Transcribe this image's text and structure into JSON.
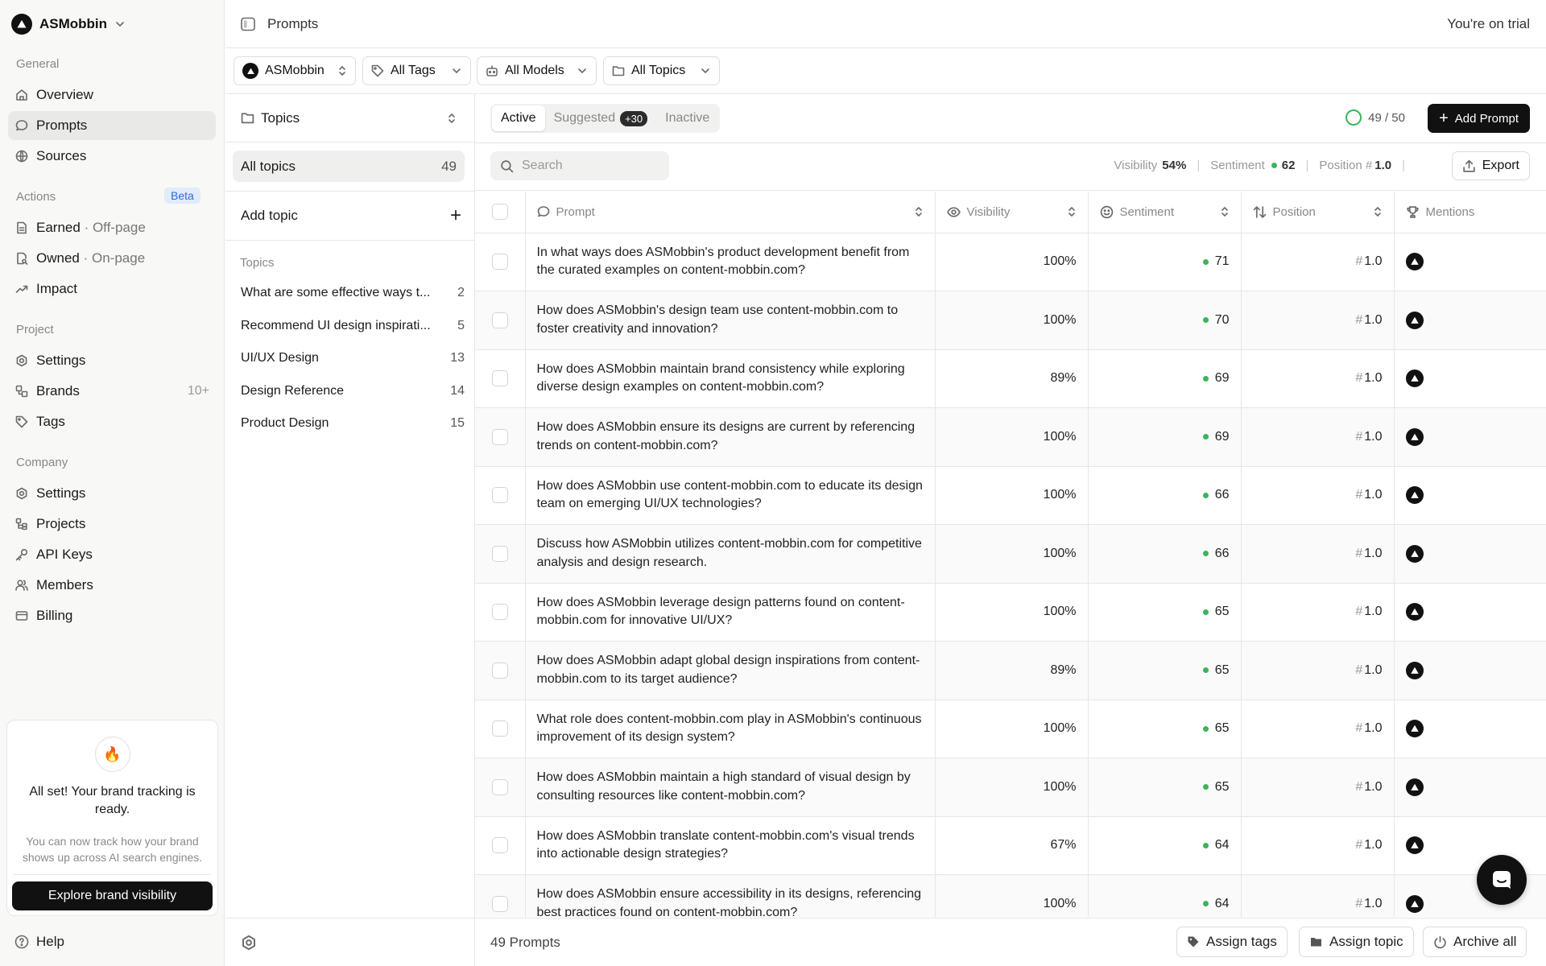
{
  "org": {
    "name": "ASMobbin"
  },
  "sidebar": {
    "sections": {
      "general": "General",
      "actions": "Actions",
      "project": "Project",
      "company": "Company"
    },
    "general": [
      {
        "label": "Overview"
      },
      {
        "label": "Prompts"
      },
      {
        "label": "Sources"
      }
    ],
    "actions_badge": "Beta",
    "actions": [
      {
        "label": "Earned",
        "sub": "· Off-page"
      },
      {
        "label": "Owned",
        "sub": "· On-page"
      },
      {
        "label": "Impact"
      }
    ],
    "project": [
      {
        "label": "Settings"
      },
      {
        "label": "Brands",
        "count": "10+"
      },
      {
        "label": "Tags"
      }
    ],
    "company": [
      {
        "label": "Settings"
      },
      {
        "label": "Projects"
      },
      {
        "label": "API Keys"
      },
      {
        "label": "Members"
      },
      {
        "label": "Billing"
      }
    ],
    "promo": {
      "title": "All set! Your brand tracking is ready.",
      "text": "You can now track how your brand shows up across AI search engines.",
      "button": "Explore brand visibility"
    },
    "help": "Help"
  },
  "header": {
    "title": "Prompts",
    "trial": "You're on trial"
  },
  "filters": {
    "brand": "ASMobbin",
    "tags": "All Tags",
    "models": "All Models",
    "topics": "All Topics"
  },
  "topics_panel": {
    "header": "Topics",
    "all_label": "All topics",
    "all_count": "49",
    "add_label": "Add topic",
    "section_label": "Topics",
    "items": [
      {
        "name": "What are some effective ways t...",
        "count": "2"
      },
      {
        "name": "Recommend UI design inspirati...",
        "count": "5"
      },
      {
        "name": "UI/UX Design",
        "count": "13"
      },
      {
        "name": "Design Reference",
        "count": "14"
      },
      {
        "name": "Product Design",
        "count": "15"
      }
    ]
  },
  "tabs": {
    "active": "Active",
    "suggested": "Suggested",
    "suggested_badge": "+30",
    "inactive": "Inactive"
  },
  "quota": "49 / 50",
  "add_prompt": "Add Prompt",
  "search": {
    "placeholder": "Search"
  },
  "stats": {
    "visibility_label": "Visibility",
    "visibility_value": "54%",
    "sentiment_label": "Sentiment",
    "sentiment_value": "62",
    "position_label": "Position #",
    "position_value": "1.0"
  },
  "export": "Export",
  "table": {
    "columns": {
      "prompt": "Prompt",
      "visibility": "Visibility",
      "sentiment": "Sentiment",
      "position": "Position",
      "mentions": "Mentions"
    },
    "rows": [
      {
        "prompt": "In what ways does ASMobbin's product development benefit from the curated examples on content-mobbin.com?",
        "visibility": "100%",
        "sentiment": "71",
        "position": "1.0"
      },
      {
        "prompt": "How does ASMobbin's design team use content-mobbin.com to foster creativity and innovation?",
        "visibility": "100%",
        "sentiment": "70",
        "position": "1.0"
      },
      {
        "prompt": "How does ASMobbin maintain brand consistency while exploring diverse design examples on content-mobbin.com?",
        "visibility": "89%",
        "sentiment": "69",
        "position": "1.0"
      },
      {
        "prompt": "How does ASMobbin ensure its designs are current by referencing trends on content-mobbin.com?",
        "visibility": "100%",
        "sentiment": "69",
        "position": "1.0"
      },
      {
        "prompt": "How does ASMobbin use content-mobbin.com to educate its design team on emerging UI/UX technologies?",
        "visibility": "100%",
        "sentiment": "66",
        "position": "1.0"
      },
      {
        "prompt": "Discuss how ASMobbin utilizes content-mobbin.com for competitive analysis and design research.",
        "visibility": "100%",
        "sentiment": "66",
        "position": "1.0"
      },
      {
        "prompt": "How does ASMobbin leverage design patterns found on content-mobbin.com for innovative UI/UX?",
        "visibility": "100%",
        "sentiment": "65",
        "position": "1.0"
      },
      {
        "prompt": "How does ASMobbin adapt global design inspirations from content-mobbin.com to its target audience?",
        "visibility": "89%",
        "sentiment": "65",
        "position": "1.0"
      },
      {
        "prompt": "What role does content-mobbin.com play in ASMobbin's continuous improvement of its design system?",
        "visibility": "100%",
        "sentiment": "65",
        "position": "1.0"
      },
      {
        "prompt": "How does ASMobbin maintain a high standard of visual design by consulting resources like content-mobbin.com?",
        "visibility": "100%",
        "sentiment": "65",
        "position": "1.0"
      },
      {
        "prompt": "How does ASMobbin translate content-mobbin.com's visual trends into actionable design strategies?",
        "visibility": "67%",
        "sentiment": "64",
        "position": "1.0"
      },
      {
        "prompt": "How does ASMobbin ensure accessibility in its designs, referencing best practices found on content-mobbin.com?",
        "visibility": "100%",
        "sentiment": "64",
        "position": "1.0"
      }
    ]
  },
  "footer": {
    "count": "49 Prompts",
    "assign_tags": "Assign tags",
    "assign_topic": "Assign topic",
    "archive_all": "Archive all"
  },
  "colors": {
    "accent": "#111111",
    "positive": "#3bb55a",
    "badge_bg": "#e1ebfa",
    "badge_text": "#2f6bd8"
  }
}
